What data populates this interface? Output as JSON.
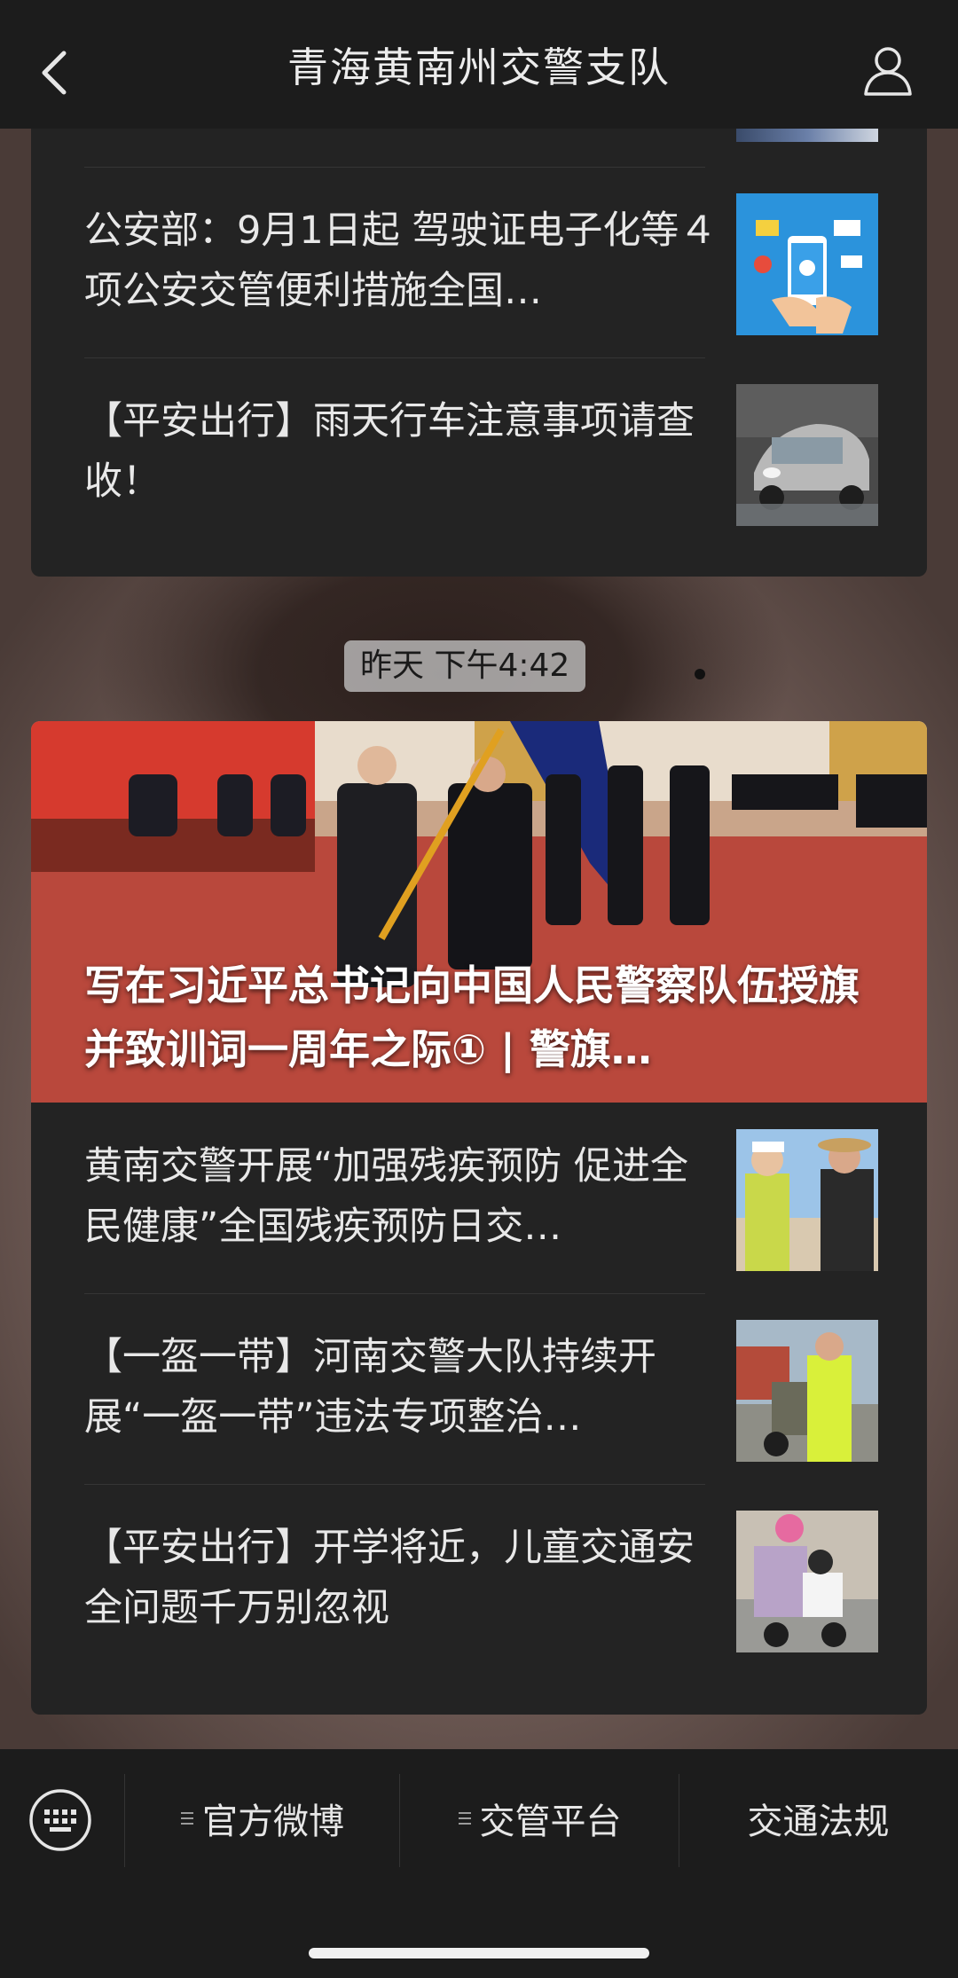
{
  "header": {
    "title": "青海黄南州交警支队"
  },
  "top_card": {
    "items": [
      {
        "title": "公安部：9月1日起 驾驶证电子化等４项公安交管便利措施全国…"
      },
      {
        "title": "【平安出行】雨天行车注意事项请查收！"
      }
    ]
  },
  "timestamp": "昨天 下午4:42",
  "article_card": {
    "hero_title": "写在习近平总书记向中国人民警察队伍授旗并致训词一周年之际① | 警旗…",
    "items": [
      {
        "title": "黄南交警开展“加强残疾预防 促进全民健康”全国残疾预防日交…"
      },
      {
        "title": "【一盔一带】河南交警大队持续开展“一盔一带”违法专项整治…"
      },
      {
        "title": "【平安出行】开学将近，儿童交通安全问题千万别忽视"
      }
    ]
  },
  "bottom_menu": {
    "items": [
      {
        "label": "官方微博"
      },
      {
        "label": "交管平台"
      },
      {
        "label": "交通法规"
      }
    ]
  },
  "colors": {
    "bar_background": "#1c1c1c",
    "card_background": "#232323",
    "text": "#e8e8e8"
  },
  "icons": [
    "back-arrow-icon",
    "profile-icon",
    "keyboard-icon",
    "menu-lines-icon"
  ]
}
